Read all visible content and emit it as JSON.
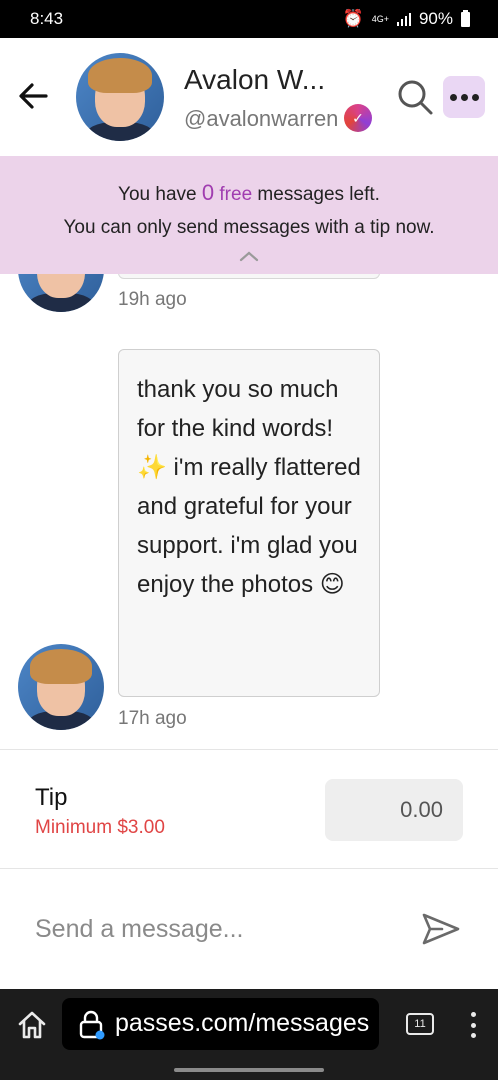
{
  "status_bar": {
    "time": "8:43",
    "network": "4G+",
    "battery": "90%"
  },
  "header": {
    "name": "Avalon W...",
    "handle": "@avalonwarren",
    "verified_mark": "✓"
  },
  "banner": {
    "line1_prefix": "You have ",
    "free_count": "0",
    "free_word": " free",
    "line1_suffix": " messages left.",
    "line2": "You can only send messages with a tip now."
  },
  "messages": [
    {
      "time": "19h ago"
    },
    {
      "text": "thank you so much for the kind words! ✨ i'm really flattered and grateful for your support. i'm glad you enjoy the photos 😊",
      "time": "17h ago"
    }
  ],
  "tip": {
    "label": "Tip",
    "minimum": "Minimum $3.00",
    "value": "0.00"
  },
  "compose": {
    "placeholder": "Send a message..."
  },
  "browser": {
    "url": "passes.com/messages",
    "tab_count": "11"
  },
  "colors": {
    "accent": "#a03db0",
    "banner_bg": "#ecd3ea",
    "error": "#e04545"
  },
  "icons": [
    "back-arrow-icon",
    "verified-badge-icon",
    "search-icon",
    "more-icon",
    "chevron-up-icon",
    "send-icon",
    "home-icon",
    "lock-icon",
    "tabs-icon",
    "kebab-menu-icon"
  ]
}
